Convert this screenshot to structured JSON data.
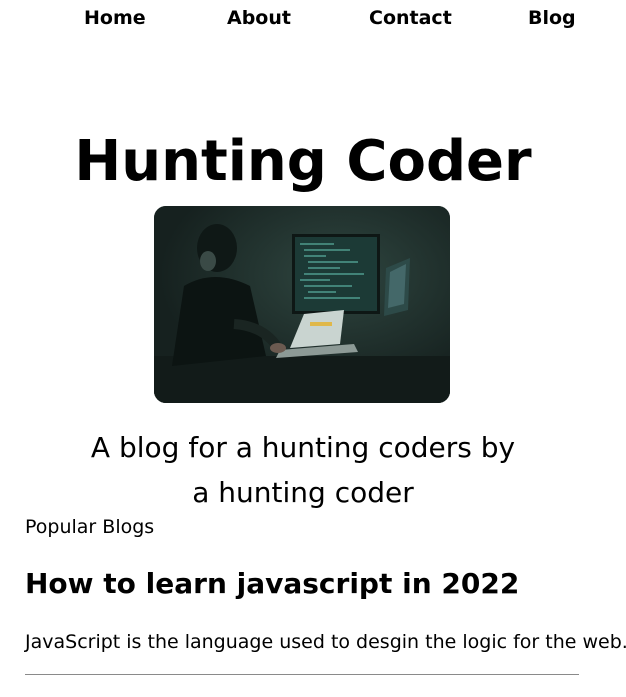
{
  "nav": {
    "items": [
      {
        "label": "Home"
      },
      {
        "label": "About"
      },
      {
        "label": "Contact"
      },
      {
        "label": "Blog"
      }
    ]
  },
  "hero": {
    "title": "Hunting Coder",
    "image_icon": "coder-at-desk-image",
    "tagline_line1": "A blog for a hunting coders by",
    "tagline_line2": "a hunting coder"
  },
  "blogs": {
    "heading": "Popular Blogs",
    "posts": [
      {
        "title": "How to learn javascript in 2022",
        "description": "JavaScript is the language used to desgin the logic for the web."
      }
    ]
  },
  "colors": {
    "image_background": "#1e2d2a",
    "divider": "#8a8a8a"
  }
}
